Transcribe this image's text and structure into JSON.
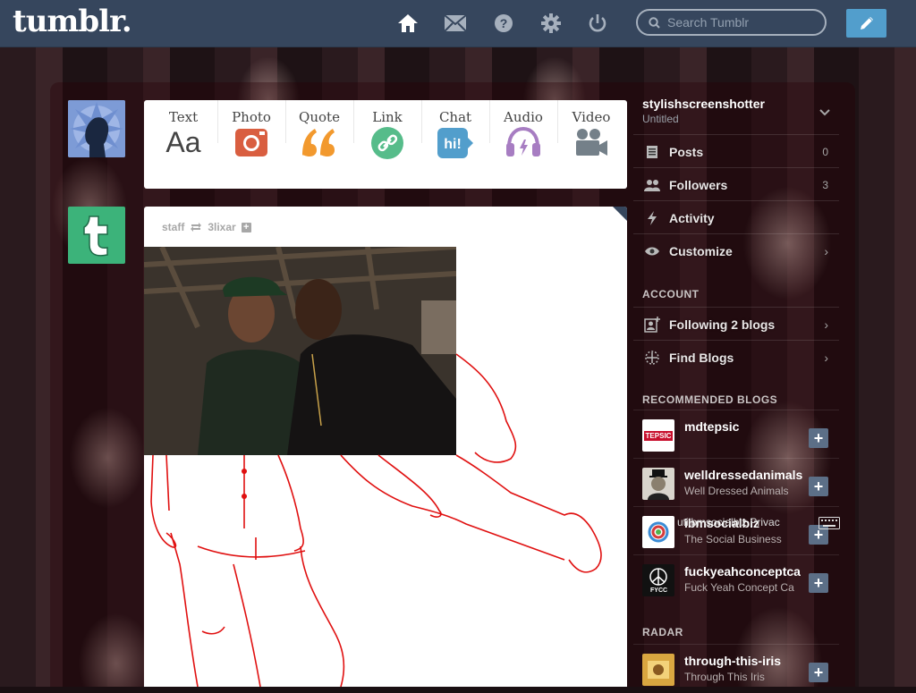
{
  "header": {
    "logo": "tumblr.",
    "search_placeholder": "Search Tumblr",
    "nav_icons": [
      "home-icon",
      "mail-icon",
      "help-icon",
      "gear-icon",
      "power-icon"
    ],
    "post_button_icon": "pencil-icon"
  },
  "post_types": [
    {
      "label": "Text",
      "icon": "text-icon",
      "color": "#444444"
    },
    {
      "label": "Photo",
      "icon": "camera-icon",
      "color": "#d95e40"
    },
    {
      "label": "Quote",
      "icon": "quote-icon",
      "color": "#f2992e"
    },
    {
      "label": "Link",
      "icon": "link-icon",
      "color": "#56bc8a"
    },
    {
      "label": "Chat",
      "icon": "chat-icon",
      "color": "#529ecc"
    },
    {
      "label": "Audio",
      "icon": "headphones-icon",
      "color": "#a77dc2"
    },
    {
      "label": "Video",
      "icon": "video-camera-icon",
      "color": "#748089"
    }
  ],
  "post": {
    "author": "staff",
    "reblogged_from": "3lixar",
    "follow_icon": "plus-icon"
  },
  "sidebar": {
    "blog_name": "stylishscreenshotter",
    "blog_subtitle": "Untitled",
    "items": [
      {
        "label": "Posts",
        "count": "0",
        "icon": "posts-icon"
      },
      {
        "label": "Followers",
        "count": "3",
        "icon": "followers-icon"
      },
      {
        "label": "Activity",
        "count": "",
        "icon": "activity-icon"
      },
      {
        "label": "Customize",
        "count": "",
        "icon": "eye-icon"
      }
    ],
    "account_heading": "ACCOUNT",
    "account_items": [
      {
        "label": "Following 2 blogs",
        "icon": "add-person-icon"
      },
      {
        "label": "Find Blogs",
        "icon": "compass-icon"
      }
    ],
    "recommended_heading": "RECOMMENDED BLOGS",
    "recommended": [
      {
        "name": "mdtepsic",
        "subtitle": "",
        "thumb_text": "TEPSIC",
        "thumb_color": "#c8102e"
      },
      {
        "name": "welldressedanimals",
        "subtitle": "Well Dressed Animals",
        "thumb_text": "",
        "thumb_color": "#9a8f80"
      },
      {
        "name": "ibmsocialbiz",
        "subtitle": "The Social Business",
        "thumb_text": "",
        "thumb_color": "#ffffff"
      },
      {
        "name": "fuckyeahconceptca",
        "subtitle": "Fuck Yeah Concept Ca",
        "thumb_text": "FYCC",
        "thumb_color": "#111111"
      }
    ],
    "radar_heading": "RADAR",
    "radar": [
      {
        "name": "through-this-iris",
        "subtitle": "Through This Iris",
        "thumb_color": "#d9a640"
      }
    ]
  },
  "footer_overlay": "utilbmsocialbiz Privac"
}
